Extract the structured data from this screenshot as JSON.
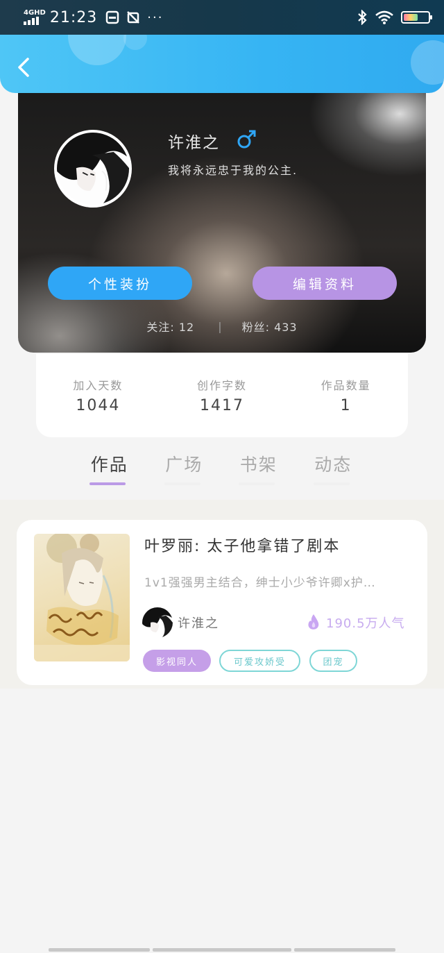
{
  "status_bar": {
    "network": "4GHD",
    "time": "21:23",
    "more": "···"
  },
  "header": {
    "back_icon": "chevron-left-icon"
  },
  "profile": {
    "name": "许淮之",
    "gender_icon": "male-icon",
    "bio": "我将永远忠于我的公主.",
    "buttons": {
      "dress_up": "个性装扮",
      "edit_profile": "编辑资料"
    },
    "following_label": "关注: 12",
    "separator": "|",
    "fans_label": "粉丝: 433"
  },
  "stats": [
    {
      "label": "加入天数",
      "value": "1044"
    },
    {
      "label": "创作字数",
      "value": "1417"
    },
    {
      "label": "作品数量",
      "value": "1"
    }
  ],
  "tabs": [
    {
      "label": "作品",
      "active": true
    },
    {
      "label": "广场",
      "active": false
    },
    {
      "label": "书架",
      "active": false
    },
    {
      "label": "动态",
      "active": false
    }
  ],
  "books": [
    {
      "title": "叶罗丽: 太子他拿错了剧本",
      "description": "1v1强强男主结合，绅士小少爷许卿x护…",
      "author": "许淮之",
      "popularity": "190.5万人气",
      "popularity_icon": "fire-icon",
      "tags": [
        "影视同人",
        "可爱攻娇受",
        "团宠"
      ]
    }
  ],
  "colors": {
    "header_blue": "#36b4f3",
    "button_blue": "#2fa6f6",
    "button_purple": "#b794e4",
    "tab_underline": "#bb9ae6",
    "tag_teal": "#7ed6d6"
  }
}
